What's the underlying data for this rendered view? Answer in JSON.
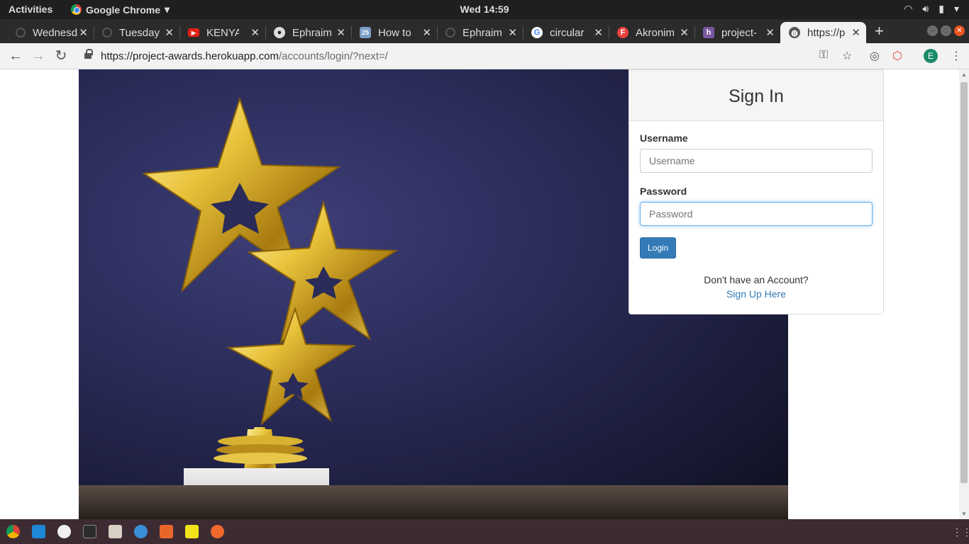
{
  "system": {
    "activities": "Activities",
    "app_name": "Google Chrome",
    "clock": "Wed 14:59"
  },
  "tabs": [
    {
      "label": "Wednesday",
      "icon": "loading-icon"
    },
    {
      "label": "Tuesday",
      "icon": "loading-icon"
    },
    {
      "label": "KENYA",
      "icon": "youtube-icon"
    },
    {
      "label": "Ephraim",
      "icon": "github-icon"
    },
    {
      "label": "How to",
      "icon": "calendar-25-icon"
    },
    {
      "label": "Ephraim",
      "icon": "loading-icon"
    },
    {
      "label": "circular",
      "icon": "google-icon"
    },
    {
      "label": "Akronim",
      "icon": "font-icon"
    },
    {
      "label": "project-",
      "icon": "heroku-icon"
    },
    {
      "label": "https://p",
      "icon": "globe-icon"
    }
  ],
  "omnibox": {
    "url_host": "https://project-awards.herokuapp.com",
    "url_path": "/accounts/login/?next=/",
    "profile_initial": "E"
  },
  "login": {
    "title": "Sign In",
    "username_label": "Username",
    "username_placeholder": "Username",
    "password_label": "Password",
    "password_placeholder": "Password",
    "submit": "Login",
    "no_account": "Don't have an Account?",
    "signup_link": "Sign Up Here"
  },
  "colors": {
    "primary": "#337ab7",
    "hero_bg": "#2a2b58",
    "dock_bg": "#3d2b33"
  }
}
